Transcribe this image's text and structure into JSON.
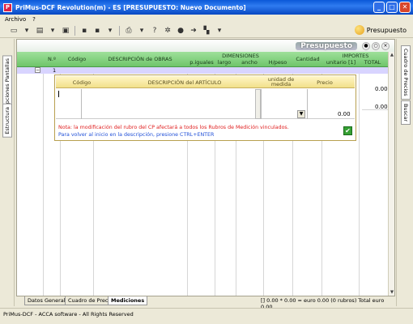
{
  "window": {
    "title": "PriMus-DCF  Revolution(m) - ES  [PRESUPUESTO: Nuevo Documento]",
    "btn_min": "_",
    "btn_max": "□",
    "btn_close": "✕"
  },
  "menu": {
    "items": [
      "Archivo",
      "?"
    ]
  },
  "toolbar": {
    "indicator_label": "Presupuesto"
  },
  "left_rail": {
    "tab_top": "Opciones Pantallas",
    "tab_bottom": "Estructura"
  },
  "right_rail": {
    "tab_top": "Cuadro de Precios",
    "tab_bottom": "Buscar"
  },
  "main": {
    "header_title": "Presupuesto",
    "columns": {
      "num": "N.º",
      "codigo": "Código",
      "descripcion": "DESCRIPCIÓN de OBRAS",
      "dimensiones": "DIMENSIONES",
      "p_iguales": "p.iguales",
      "largo": "largo",
      "ancho": "ancho",
      "hpeso": "H/peso",
      "cantidad": "Cantidad",
      "importes": "IMPORTES",
      "unitario": "unitario [1]",
      "total": "TOTAL"
    },
    "first_row": {
      "expander": "−",
      "num": "1"
    },
    "right_values": [
      "0.00",
      "0.00"
    ]
  },
  "subform": {
    "columns": {
      "codigo": "Código",
      "descripcion": "DESCRIPCIÓN del ARTÍCULO",
      "unidad": "unidad de medida",
      "precio": "Precio"
    },
    "price_value": "0.00",
    "note_red": "Nota: la modificación del rubro del CP afectará a todos los Rubros de Medición vinculados.",
    "note_blue": "Para volver al inicio en la descripción, presione CTRL+ENTER",
    "ok_glyph": "✔"
  },
  "bottom_tabs": [
    "Datos Generales",
    "Cuadro de Precios",
    "Mediciones"
  ],
  "bottom_summary": "[] 0.00 * 0.00 = euro 0.00    (0 rubros)  Total   euro   0.00",
  "status": {
    "copyright": "PriMus-DCF - ACCA software - All Rights Reserved"
  }
}
